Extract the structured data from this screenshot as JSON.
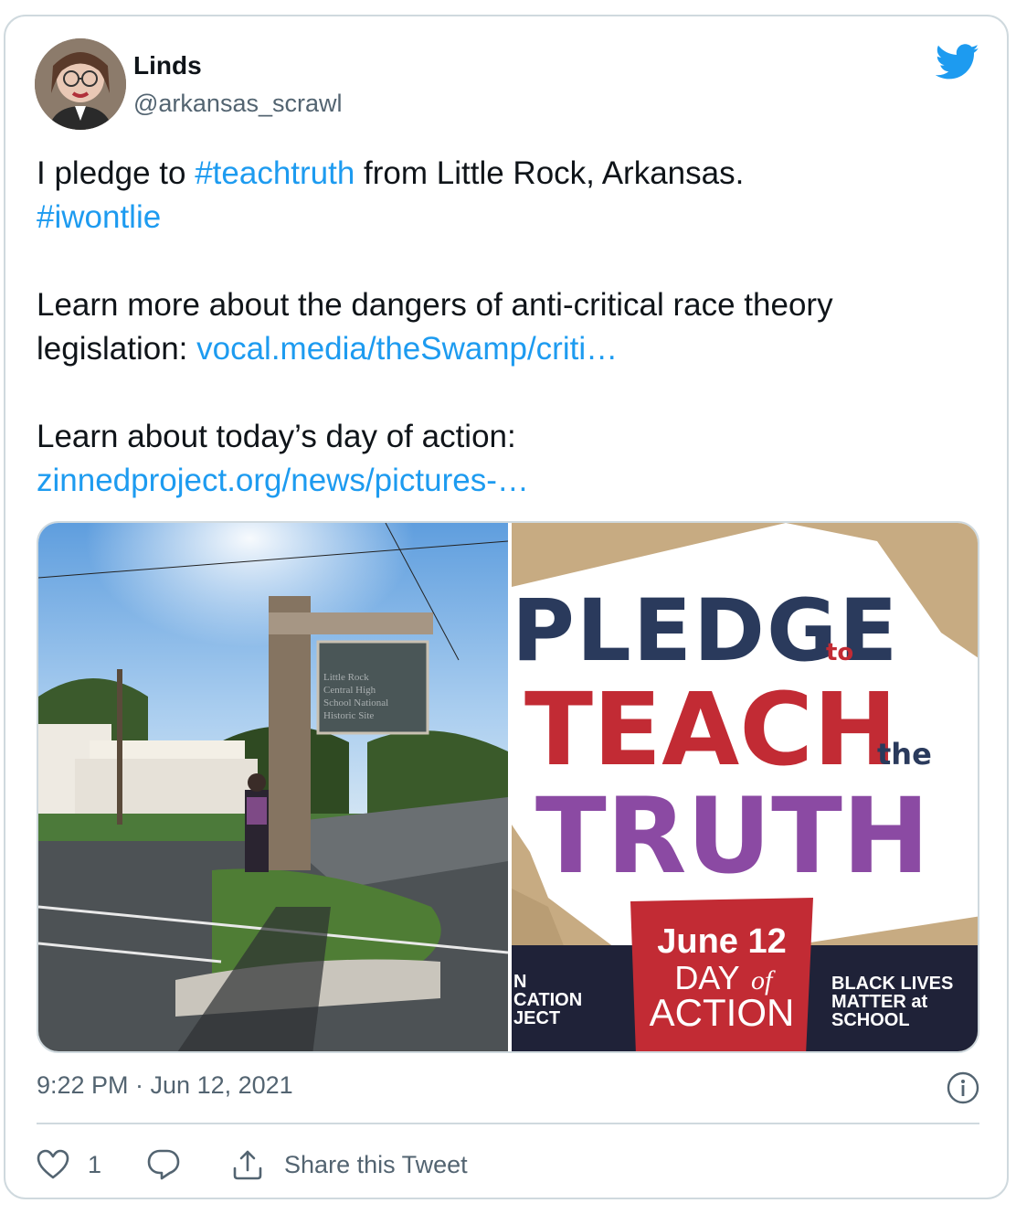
{
  "author": {
    "name": "Linds",
    "handle": "@arkansas_scrawl"
  },
  "tweet": {
    "line1_pre": "I pledge to ",
    "hashtag1": "#teachtruth",
    "line1_post": " from Little Rock, Arkansas.",
    "hashtag2": "#iwontlie",
    "para2_text": "Learn more about the dangers of anti-critical race theory legislation: ",
    "link1": "vocal.media/theSwamp/criti…",
    "para3_text": "Learn about today’s day of action:",
    "link2": "zinnedproject.org/news/pictures-…"
  },
  "media": {
    "photo_sign_text": [
      "Little Rock",
      "Central High",
      "School National",
      "Historic Site"
    ],
    "poster": {
      "pledge": "PLEDGE",
      "to": "to",
      "teach": "TEACH",
      "the": "the",
      "truth": "TRUTH",
      "date": "June 12",
      "day": "DAY",
      "of": "of",
      "action": "ACTION",
      "left_org_line1": "N",
      "left_org_line2": "CATION",
      "left_org_line3": "JECT",
      "right_org_line1": "BLACK LIVES",
      "right_org_line2": "MATTER at",
      "right_org_line3": "SCHOOL"
    }
  },
  "meta": {
    "timestamp": "9:22 PM · Jun 12, 2021"
  },
  "actions": {
    "like_count": "1",
    "share_label": "Share this Tweet"
  },
  "colors": {
    "link": "#1d9bf0",
    "secondary_text": "#536471",
    "border": "#cfd9de",
    "twitter_blue": "#1d9bf0"
  },
  "icons": [
    "twitter-bird-icon",
    "info-icon",
    "heart-icon",
    "reply-icon",
    "share-icon"
  ]
}
